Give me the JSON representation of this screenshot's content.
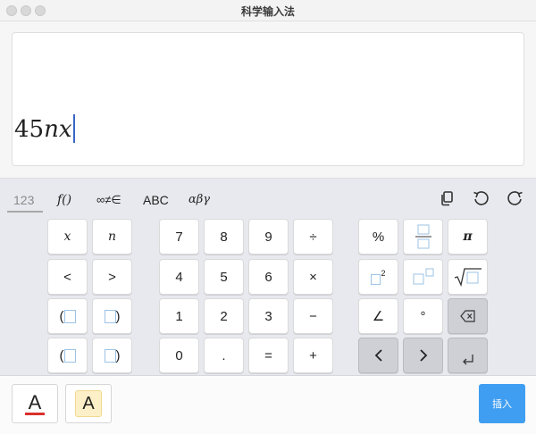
{
  "window": {
    "title": "科学输入法"
  },
  "editor": {
    "content": [
      "45",
      "nx"
    ]
  },
  "tabs": [
    {
      "label": "123",
      "active": true
    },
    {
      "label": "f()"
    },
    {
      "label": "∞≠∈"
    },
    {
      "label": "ABC"
    },
    {
      "label": "αβγ"
    }
  ],
  "toolbar": {
    "copy_icon": "copy-icon",
    "undo_icon": "undo-icon",
    "redo_icon": "redo-icon"
  },
  "keys": {
    "var_x": "x",
    "var_n": "n",
    "lt": "<",
    "gt": ">",
    "lparen": "(",
    "rparen": ")",
    "d7": "7",
    "d8": "8",
    "d9": "9",
    "div": "÷",
    "d4": "4",
    "d5": "5",
    "d6": "6",
    "mul": "×",
    "d1": "1",
    "d2": "2",
    "d3": "3",
    "minus": "−",
    "d0": "0",
    "dot": ".",
    "eq": "=",
    "plus": "+",
    "percent": "%",
    "pi": "π",
    "sq_exp": "2",
    "angle": "∠",
    "degree": "°",
    "backspace_icon": "backspace-icon",
    "left_icon": "chevron-left-icon",
    "right_icon": "chevron-right-icon",
    "enter_icon": "enter-icon"
  },
  "bottom": {
    "font_color_letter": "A",
    "highlight_letter": "A",
    "insert_label": "插入"
  },
  "colors": {
    "accent": "#3f9ef2",
    "font_color_underline": "#d9302c",
    "highlight_fill": "#fdf0c8",
    "caret": "#3a66c4"
  }
}
